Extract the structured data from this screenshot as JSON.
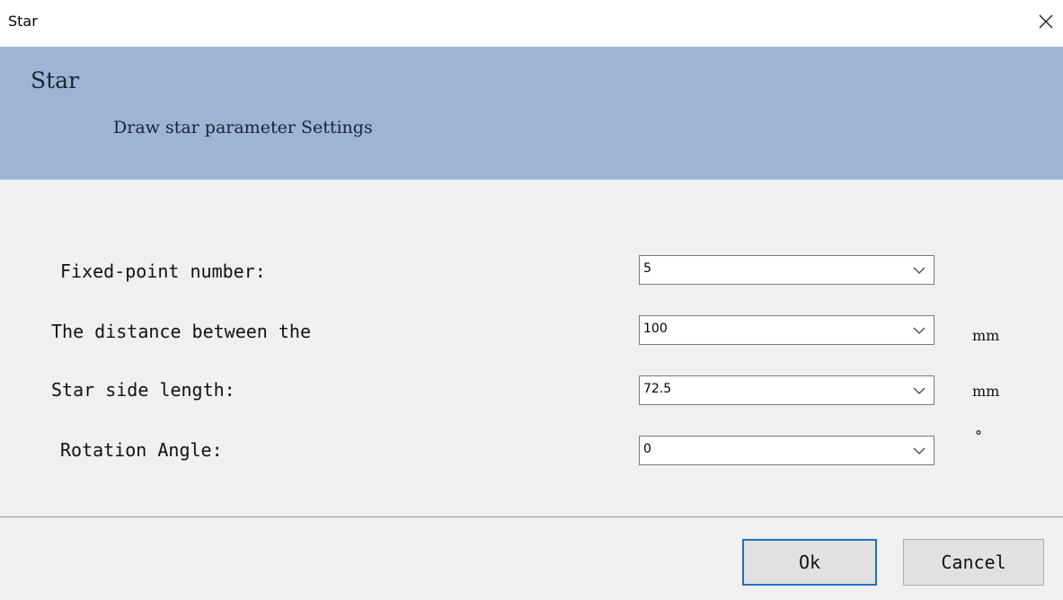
{
  "window": {
    "title": "Star",
    "close_glyph": "×"
  },
  "banner": {
    "title": "Star",
    "subtitle": "Draw star parameter Settings"
  },
  "form": {
    "rows": [
      {
        "label": "Fixed-point number:",
        "value": "5",
        "unit": ""
      },
      {
        "label": "The distance between the",
        "value": "100",
        "unit": "mm"
      },
      {
        "label": "Star side length:",
        "value": "72.5",
        "unit": "mm"
      },
      {
        "label": "Rotation Angle:",
        "value": "0",
        "unit": "°"
      }
    ]
  },
  "buttons": {
    "ok": "Ok",
    "cancel": "Cancel"
  },
  "colors": {
    "banner": "#9db4d3",
    "body": "#f0f0f0",
    "default_button_border": "#1f6fbf"
  },
  "icons": {
    "close": "close-icon",
    "dropdown": "chevron-down-icon"
  }
}
